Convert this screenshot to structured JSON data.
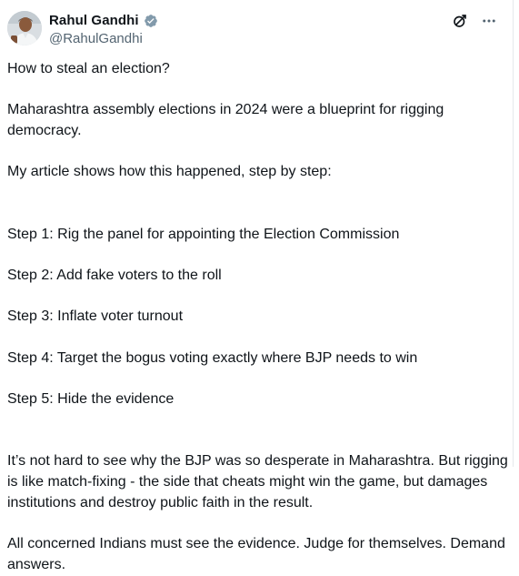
{
  "author": {
    "display_name": "Rahul Gandhi",
    "handle": "@RahulGandhi",
    "verified_icon": "verified-badge-icon",
    "accent_color": "#1d9bf0"
  },
  "header_actions": {
    "grok_icon": "grok-icon",
    "more_icon": "more-options-icon"
  },
  "post": {
    "intro": "How to steal an election?",
    "thesis": "Maharashtra assembly elections in 2024 were a blueprint for rigging democracy.",
    "lead": "My article shows how this happened, step by step:",
    "steps": [
      "Step 1: Rig the panel for appointing the Election Commission",
      "Step 2: Add fake voters to the roll",
      "Step 3: Inflate voter turnout",
      "Step 4: Target the bogus voting exactly where BJP needs to win",
      "Step 5: Hide the evidence"
    ],
    "argument": "It’s not hard to see why the BJP was so desperate in Maharashtra. But rigging is like match-fixing - the side that cheats might win the game, but damages institutions and destroy public faith in the result.",
    "closing": "All concerned Indians must see the evidence. Judge for themselves. Demand answers."
  }
}
